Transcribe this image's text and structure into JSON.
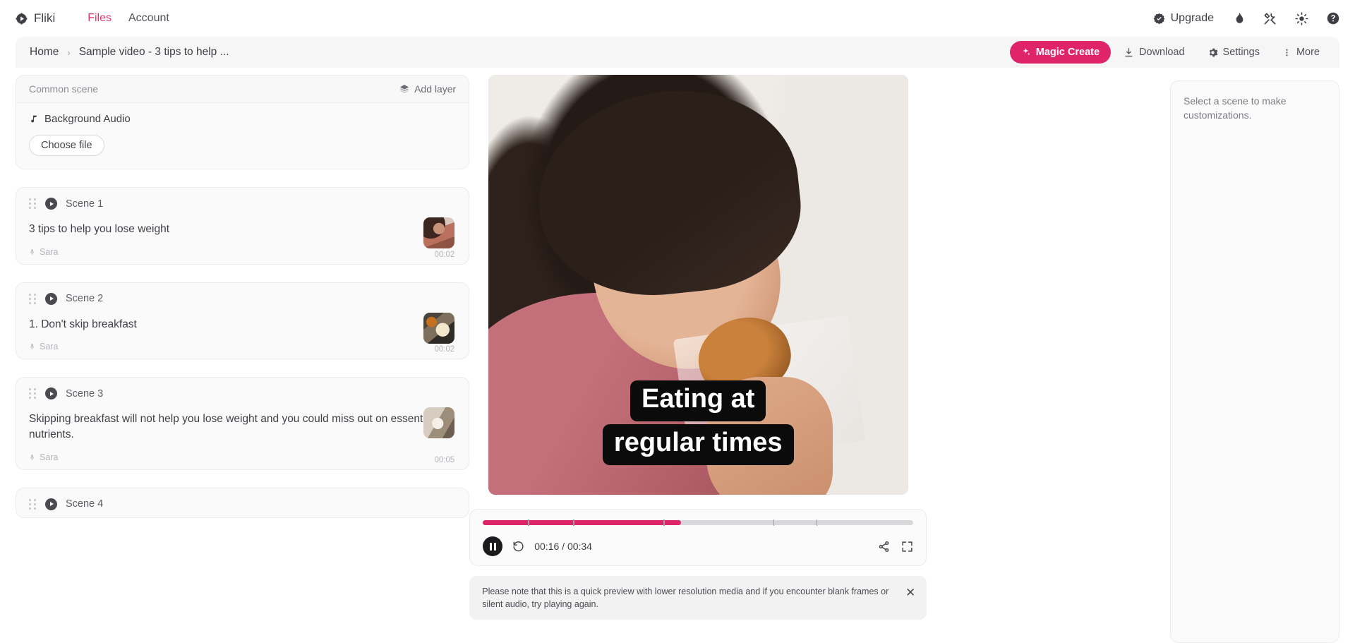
{
  "nav": {
    "brand": "Fliki",
    "brand_icon": "fliki-logo-icon",
    "links": [
      {
        "label": "Files",
        "active": true
      },
      {
        "label": "Account",
        "active": false
      }
    ],
    "upgrade_label": "Upgrade",
    "icons": [
      "badge-check-icon",
      "flame-icon",
      "tools-icon",
      "sun-icon",
      "help-circle-icon"
    ],
    "accent": "#e0246a"
  },
  "breadcrumb": {
    "home": "Home",
    "separator": "›",
    "current": "Sample video - 3 tips to help ...",
    "actions": {
      "magic_create": "Magic Create",
      "download": "Download",
      "settings": "Settings",
      "more": "More"
    }
  },
  "common_scene": {
    "title": "Common scene",
    "add_layer": "Add layer",
    "background_audio": "Background Audio",
    "choose_file": "Choose file"
  },
  "scenes": [
    {
      "label": "Scene 1",
      "text": "3 tips to help you lose weight",
      "voice": "Sara",
      "duration": "00:02",
      "thumb": "th-girl"
    },
    {
      "label": "Scene 2",
      "text": "1. Don't skip breakfast",
      "voice": "Sara",
      "duration": "00:02",
      "thumb": "th-breakfast"
    },
    {
      "label": "Scene 3",
      "text": "Skipping breakfast will not help you lose weight and you could miss out on essential nutrients.",
      "voice": "Sara",
      "duration": "00:05",
      "thumb": "th-coffee"
    },
    {
      "label": "Scene 4",
      "text": "",
      "voice": "",
      "duration": "",
      "thumb": ""
    }
  ],
  "video": {
    "caption_line_1": "Eating at",
    "caption_line_2": "regular times"
  },
  "player": {
    "current_time": "00:16",
    "total_time": "00:34",
    "time_display": "00:16 / 00:34",
    "progress_percent": 46,
    "scene_marks": [
      10.5,
      21,
      42,
      46,
      67.5,
      77.5
    ],
    "state": "playing",
    "pause_icon": "pause-icon",
    "restart_icon": "restart-icon",
    "share_icon": "share-icon",
    "fullscreen_icon": "fullscreen-icon",
    "progress_color": "#e0246a"
  },
  "notice": {
    "text": "Please note that this is a quick preview with lower resolution media and if you encounter blank frames or silent audio, try playing again.",
    "close": "✕"
  },
  "right_panel": {
    "message": "Select a scene to make customizations."
  }
}
